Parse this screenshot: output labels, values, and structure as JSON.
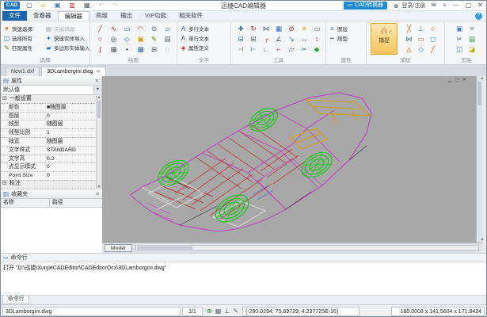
{
  "titlebar": {
    "logo": "CAD",
    "title": "迅捷CAD编辑器",
    "quick_icons": [
      {
        "n": "new-file-icon",
        "g": "▢",
        "c": "#556066"
      },
      {
        "n": "open-folder-icon",
        "g": "▱",
        "c": "#c8a400"
      },
      {
        "n": "save-icon",
        "g": "▣",
        "c": "#4a7ab5"
      },
      {
        "n": "export-pdf-icon",
        "g": "▥",
        "c": "#b03030"
      },
      {
        "n": "print-icon",
        "g": "▦",
        "c": "#556066"
      },
      {
        "n": "undo-icon",
        "g": "↶",
        "c": "#c0c4c8"
      },
      {
        "n": "redo-icon",
        "g": "↷",
        "c": "#c0c4c8"
      }
    ],
    "converter_button": {
      "icon": "▭",
      "label": "CAD转换器"
    },
    "login_label": "登录/注册",
    "window_icons": [
      {
        "n": "feedback-icon",
        "g": "✉"
      },
      {
        "n": "menu-icon",
        "g": "≡"
      },
      {
        "n": "minimize-icon",
        "g": "—"
      },
      {
        "n": "maximize-icon",
        "g": "▢"
      },
      {
        "n": "close-icon",
        "g": "✕"
      }
    ]
  },
  "tabs": [
    "文件",
    "查看器",
    "编辑器",
    "高级",
    "输出",
    "VIP功能",
    "相关软件"
  ],
  "ribbon": {
    "select": {
      "label": "选择",
      "col1": [
        {
          "n": "quick-select-button",
          "g": "▼",
          "c": "#e08a1e",
          "t": "快速选择"
        },
        {
          "n": "select-all-button",
          "g": "◫",
          "c": "#2b95c8",
          "t": "选择所有"
        },
        {
          "n": "match-properties-button",
          "g": "✎",
          "c": "#5a7f2a",
          "t": "匹配属性"
        }
      ],
      "col2": [
        {
          "n": "block-editor-button",
          "g": "▦",
          "c": "#b3b7ba",
          "t": "块编辑器",
          "dim": 1
        },
        {
          "n": "quick-entity-import-button",
          "g": "✦",
          "c": "#2b6fc8",
          "t": "快速实体导入"
        },
        {
          "n": "polygon-entity-input-button",
          "g": "▰",
          "c": "#2b6fc8",
          "t": "多边形实体输入"
        }
      ]
    },
    "draw": {
      "label": "绘图",
      "icons": [
        {
          "n": "line-icon",
          "g": "╱",
          "c": "#b03535"
        },
        {
          "n": "polyline-icon",
          "g": "∿",
          "c": "#b03535"
        },
        {
          "n": "rectangle-icon",
          "g": "▭",
          "c": "#3a6ea5"
        },
        {
          "n": "arc-icon",
          "g": "◠",
          "c": "#b03535"
        },
        {
          "n": "circle-2p-icon",
          "g": "⊙",
          "c": "#556066"
        },
        {
          "n": "parallelogram-icon",
          "g": "▱",
          "c": "#3a6ea5"
        },
        {
          "n": "circle-icon",
          "g": "○",
          "c": "#b03535"
        },
        {
          "n": "donut-icon",
          "g": "◎",
          "c": "#556066"
        },
        {
          "n": "polygon-icon",
          "g": "◇",
          "c": "#3a6ea5"
        },
        {
          "n": "block-icon",
          "g": "▣",
          "c": "#c8a400"
        },
        {
          "n": "sketch-icon",
          "g": "✎",
          "c": "#5a7f2a"
        },
        {
          "n": "table-icon",
          "g": "▤",
          "c": "#556066"
        },
        {
          "n": "spline-icon",
          "g": "∫",
          "c": "#b03535"
        },
        {
          "n": "hatch-icon",
          "g": "▦",
          "c": "#556066"
        },
        {
          "n": "point-icon",
          "g": "•",
          "c": "#222222"
        },
        {
          "n": "gradient-icon",
          "g": "▩",
          "c": "#3a6ea5"
        },
        {
          "n": "region-icon",
          "g": "⊞",
          "c": "#556066"
        },
        {
          "n": "revision-cloud-icon",
          "g": "◌",
          "c": "#3a6ea5"
        }
      ]
    },
    "text": {
      "label": "文字",
      "items": [
        {
          "n": "multiline-text-button",
          "g": "A",
          "c": "#3a6ea5",
          "t": "多行文本"
        },
        {
          "n": "single-text-button",
          "g": "A",
          "c": "#556066",
          "t": "单行文本"
        },
        {
          "n": "attribute-define-button",
          "g": "◈",
          "c": "#b03030",
          "t": "属性定义"
        }
      ]
    },
    "tools": {
      "label": "工具",
      "icons": [
        {
          "n": "move-icon",
          "g": "✚",
          "c": "#3a6ea5"
        },
        {
          "n": "rotate-icon",
          "g": "↻",
          "c": "#b03535"
        },
        {
          "n": "mirror-icon",
          "g": "⋈",
          "c": "#556066"
        },
        {
          "n": "array-icon",
          "g": "▦",
          "c": "#3a6ea5"
        },
        {
          "n": "erase-icon",
          "g": "⊘",
          "c": "#b03535"
        },
        {
          "n": "explode-icon",
          "g": "✳",
          "c": "#c8a400"
        },
        {
          "n": "offset-icon",
          "g": "▭",
          "c": "#556066"
        },
        {
          "n": "copy-object-icon",
          "g": "⊟",
          "c": "#3a6ea5"
        },
        {
          "n": "paste-object-icon",
          "g": "⊞",
          "c": "#556066"
        },
        {
          "n": "fillet-icon",
          "g": "╭",
          "c": "#b03535"
        },
        {
          "n": "chamfer-icon",
          "g": "∠",
          "c": "#556066"
        },
        {
          "n": "stretch-icon",
          "g": "↘",
          "c": "#3a6ea5"
        },
        {
          "n": "lengthen-icon",
          "g": "↔",
          "c": "#556066"
        },
        {
          "n": "scale-icon",
          "g": "↕",
          "c": "#b03535"
        },
        {
          "n": "trim-icon",
          "g": "⊣",
          "c": "#556066"
        },
        {
          "n": "extend-icon",
          "g": "⊢",
          "c": "#3a6ea5"
        },
        {
          "n": "break-icon",
          "g": "∟",
          "c": "#556066"
        },
        {
          "n": "join-icon",
          "g": "⌐",
          "c": "#b03535"
        },
        {
          "n": "align-icon",
          "g": "▱",
          "c": "#556066"
        },
        {
          "n": "measure-icon",
          "g": "✂",
          "c": "#3a6ea5"
        },
        {
          "n": "divide-icon",
          "g": "◆",
          "c": "#2f9e44"
        }
      ]
    },
    "props": {
      "label": "属性",
      "items": [
        {
          "n": "layer-button",
          "g": "≡",
          "c": "#3a6ea5",
          "t": "图层"
        },
        {
          "n": "linetype-button",
          "g": "╍",
          "c": "#556066",
          "t": "线型"
        }
      ]
    },
    "snap": {
      "label": "捕捉",
      "button_label": "捕捉",
      "icons": [
        {
          "n": "snap-intersection-icon",
          "g": "╳",
          "c": "#d2691e"
        },
        {
          "n": "snap-perpendicular-icon",
          "g": "⊥",
          "c": "#4682b4"
        },
        {
          "n": "snap-center-icon",
          "g": "○",
          "c": "#d2691e"
        },
        {
          "n": "snap-nearest-icon",
          "g": "⋈",
          "c": "#4682b4"
        },
        {
          "n": "snap-midpoint-icon",
          "g": "▭",
          "c": "#d2691e"
        },
        {
          "n": "snap-endpoint-icon",
          "g": "◻",
          "c": "#4682b4"
        },
        {
          "n": "snap-tangent-icon",
          "g": "△",
          "c": "#d2691e"
        },
        {
          "n": "snap-quadrant-icon",
          "g": "◇",
          "c": "#4682b4"
        },
        {
          "n": "snap-parallel-icon",
          "g": "╱",
          "c": "#d2691e"
        }
      ]
    },
    "clip": {
      "label": "剪贴",
      "icons": [
        {
          "n": "copy-icon",
          "g": "▣",
          "c": "#4a7ab5"
        },
        {
          "n": "delete-icon",
          "g": "✕",
          "c": "#888888"
        },
        {
          "n": "cut-icon",
          "g": "✂",
          "c": "#556066"
        },
        {
          "n": "paste-icon",
          "g": "▤",
          "c": "#2f9e44"
        },
        {
          "n": "copy-with-base-icon",
          "g": "◫",
          "c": "#4a7ab5"
        },
        {
          "n": "paste-as-block-icon",
          "g": "◪",
          "c": "#c8a400"
        }
      ]
    }
  },
  "doc_tabs": [
    {
      "name": "New1.dxf"
    },
    {
      "name": "3DLamborgini.dwg"
    }
  ],
  "properties": {
    "title": "属性",
    "selector": "默认值",
    "section_general": "一般设置",
    "rows": [
      {
        "k": "颜色",
        "v": "■随图层"
      },
      {
        "k": "图层",
        "v": "0"
      },
      {
        "k": "线型",
        "v": "随图层"
      },
      {
        "k": "线型比例",
        "v": "1"
      },
      {
        "k": "线宽",
        "v": "随图层"
      },
      {
        "k": "文字样式",
        "v": "STANDARD"
      },
      {
        "k": "文字高",
        "v": "0.2"
      },
      {
        "k": "点显示模式",
        "v": "0"
      },
      {
        "k": "Point Size",
        "v": "0"
      }
    ],
    "section_dim": "标注"
  },
  "favorites": {
    "title": "收藏夹",
    "col_name": "名称",
    "col_path": "路径"
  },
  "canvas": {
    "model_tab": "Model"
  },
  "command": {
    "title": "命令行",
    "content": "打开 \"D:\\迅捷\\XunjieCADEditor\\CADEditorOcx\\3DLamborgini.dwg\"",
    "tab": "命令行"
  },
  "statusbar": {
    "filename": "3DLamborgini.dwg",
    "page": "1/1",
    "icons": [
      {
        "n": "snap-toggle-icon",
        "g": "⊕",
        "c": "#2f9e44"
      },
      {
        "n": "grid-toggle-icon",
        "g": "▦",
        "c": "#667077"
      },
      {
        "n": "ortho-toggle-icon",
        "g": "⊥",
        "c": "#44505a"
      },
      {
        "n": "lineweight-toggle-icon",
        "g": "✎",
        "c": "#667077"
      }
    ],
    "coords": "(-280.0294; 75.69729; 4.237725E-16)",
    "dims": "180.0003 x 141.5604 x 171.8424"
  }
}
